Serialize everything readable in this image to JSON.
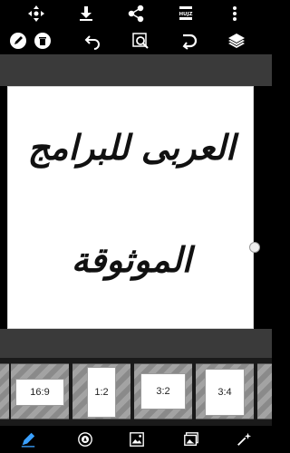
{
  "toolbar_top": {
    "items": [
      {
        "name": "move-icon"
      },
      {
        "name": "download-icon"
      },
      {
        "name": "share-icon"
      },
      {
        "name": "hujz-logo-icon",
        "text": "HUJZ"
      },
      {
        "name": "more-vertical-icon"
      }
    ]
  },
  "toolbar_second": {
    "items": [
      {
        "name": "edit-pencil-icon"
      },
      {
        "name": "delete-icon"
      },
      {
        "name": "undo-icon"
      },
      {
        "name": "zoom-search-icon"
      },
      {
        "name": "redo-icon"
      },
      {
        "name": "layers-icon"
      }
    ]
  },
  "canvas": {
    "line1": "العربى للبرامج",
    "line2": "الموثوقة"
  },
  "ratios": [
    "16:9",
    "1:2",
    "3:2",
    "3:4"
  ],
  "bottom_nav": [
    {
      "name": "brush-icon",
      "active": true
    },
    {
      "name": "badge-icon"
    },
    {
      "name": "image-edit-icon"
    },
    {
      "name": "gallery-icon"
    },
    {
      "name": "magic-wand-icon"
    }
  ],
  "colors": {
    "accent": "#3aa0ff",
    "background": "#000000"
  }
}
